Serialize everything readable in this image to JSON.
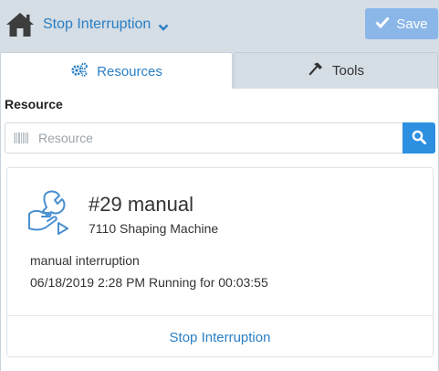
{
  "header": {
    "title": "Stop Interruption",
    "save_label": "Save",
    "home_icon": "home-icon",
    "chevron_icon": "chevron-down-icon",
    "check_icon": "check-icon"
  },
  "tabs": [
    {
      "label": "Resources",
      "icon": "gears-icon",
      "active": true
    },
    {
      "label": "Tools",
      "icon": "hammer-icon",
      "active": false
    }
  ],
  "resource": {
    "section_label": "Resource",
    "search_placeholder": "Resource",
    "search_value": "",
    "barcode_icon": "barcode-icon",
    "search_icon": "search-icon"
  },
  "card": {
    "icon": "wrench-hand-icon",
    "title": "#29 manual",
    "machine": "7110 Shaping Machine",
    "reason": "manual interruption",
    "status_line": "06/18/2019 2:28 PM Running for 00:03:55",
    "action_label": "Stop Interruption"
  },
  "colors": {
    "accent": "#2a7fc4",
    "header_bg": "#d5dde5",
    "save_button_bg": "#8bb6e8",
    "search_button_bg": "#2c8fe0"
  }
}
